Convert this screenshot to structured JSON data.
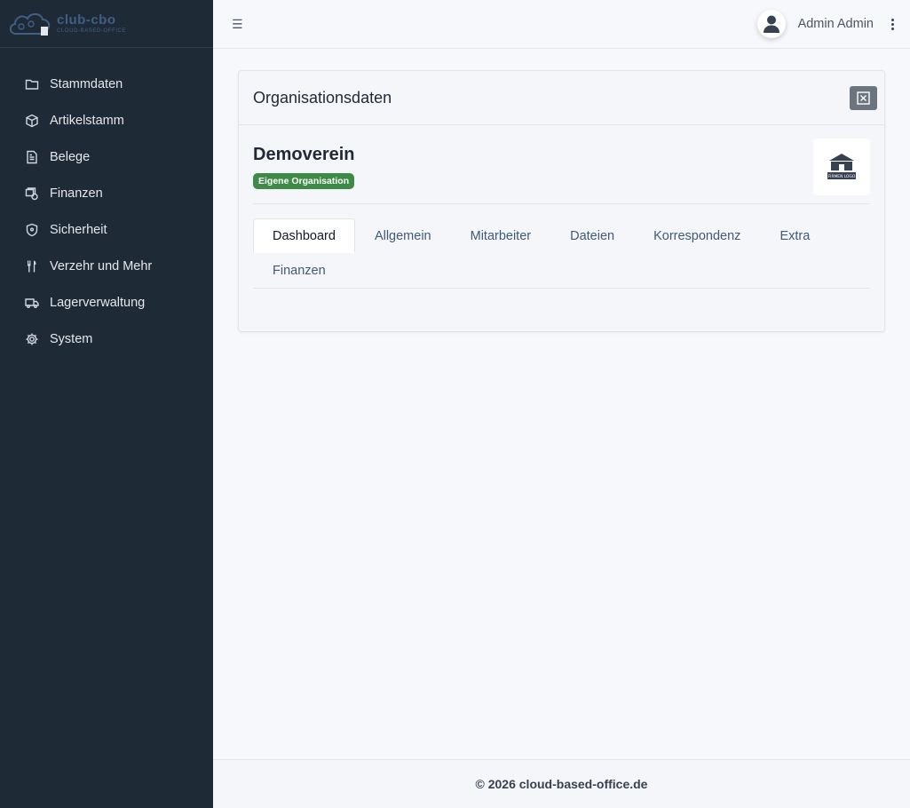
{
  "brand": {
    "name": "club-cbo",
    "tagline": "CLOUD-BASED-OFFICE"
  },
  "sidebar": {
    "items": [
      {
        "label": "Stammdaten",
        "icon": "folder-icon"
      },
      {
        "label": "Artikelstamm",
        "icon": "box-icon"
      },
      {
        "label": "Belege",
        "icon": "document-icon"
      },
      {
        "label": "Finanzen",
        "icon": "finance-icon"
      },
      {
        "label": "Sicherheit",
        "icon": "shield-icon"
      },
      {
        "label": "Verzehr und Mehr",
        "icon": "utensils-icon"
      },
      {
        "label": "Lagerverwaltung",
        "icon": "truck-icon"
      },
      {
        "label": "System",
        "icon": "gear-icon"
      }
    ]
  },
  "header": {
    "menu_icon": "hamburger-icon",
    "user_name": "Admin Admin",
    "avatar_icon": "user-icon",
    "more_icon": "kebab-menu-icon"
  },
  "card": {
    "title": "Organisationsdaten",
    "close_icon": "close-icon",
    "org_name": "Demoverein",
    "badge": "Eigene Organisation",
    "logo_text": "FIRMEN LOGO",
    "tabs": [
      {
        "label": "Dashboard",
        "active": true
      },
      {
        "label": "Allgemein"
      },
      {
        "label": "Mitarbeiter"
      },
      {
        "label": "Dateien"
      },
      {
        "label": "Korrespondenz"
      },
      {
        "label": "Extra"
      },
      {
        "label": "Finanzen"
      }
    ]
  },
  "footer": {
    "text": "© 2026 cloud-based-office.de"
  },
  "colors": {
    "sidebar_bg": "#1f2a37",
    "badge_green": "#3d8b47",
    "close_button": "#6c757d"
  }
}
